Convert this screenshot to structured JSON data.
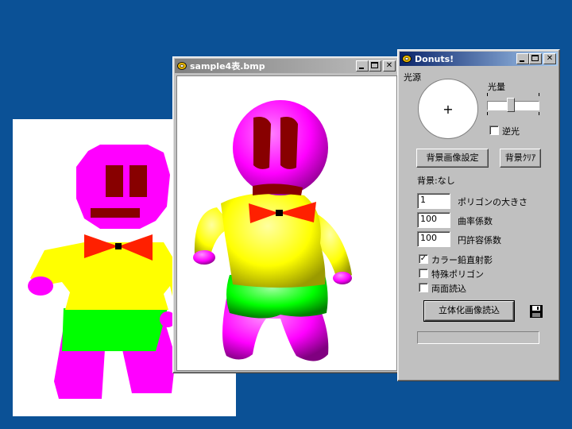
{
  "desktop": {
    "background": "#0b5196"
  },
  "image_window": {
    "title": "sample4表.bmp",
    "title_active": false
  },
  "donuts_window": {
    "title": "Donuts!",
    "light_source_label": "光源",
    "light_crosshair": "+",
    "light_amount_label": "光量",
    "light_amount_level": 0.45,
    "reverse_light_label": "逆光",
    "reverse_light_checked": false,
    "bg_image_button": "背景画像設定",
    "bg_clear_button": "背景ｸﾘｱ",
    "bg_status": "背景:なし",
    "params": [
      {
        "value": "1",
        "label": "ポリゴンの大きさ"
      },
      {
        "value": "100",
        "label": "曲率係数"
      },
      {
        "value": "100",
        "label": "円許容係数"
      }
    ],
    "options": [
      {
        "label": "カラー鉛直射影",
        "checked": true
      },
      {
        "label": "特殊ポリゴン",
        "checked": false
      },
      {
        "label": "両面読込",
        "checked": false
      }
    ],
    "load_button": "立体化画像読込",
    "save_icon": "floppy-disk-icon",
    "progress": 0
  },
  "colors": {
    "title_active": "#0a246a",
    "magenta": "#ff00ff",
    "yellow": "#ffff00",
    "green": "#00ff00",
    "red": "#ff2000",
    "brown": "#880000"
  }
}
